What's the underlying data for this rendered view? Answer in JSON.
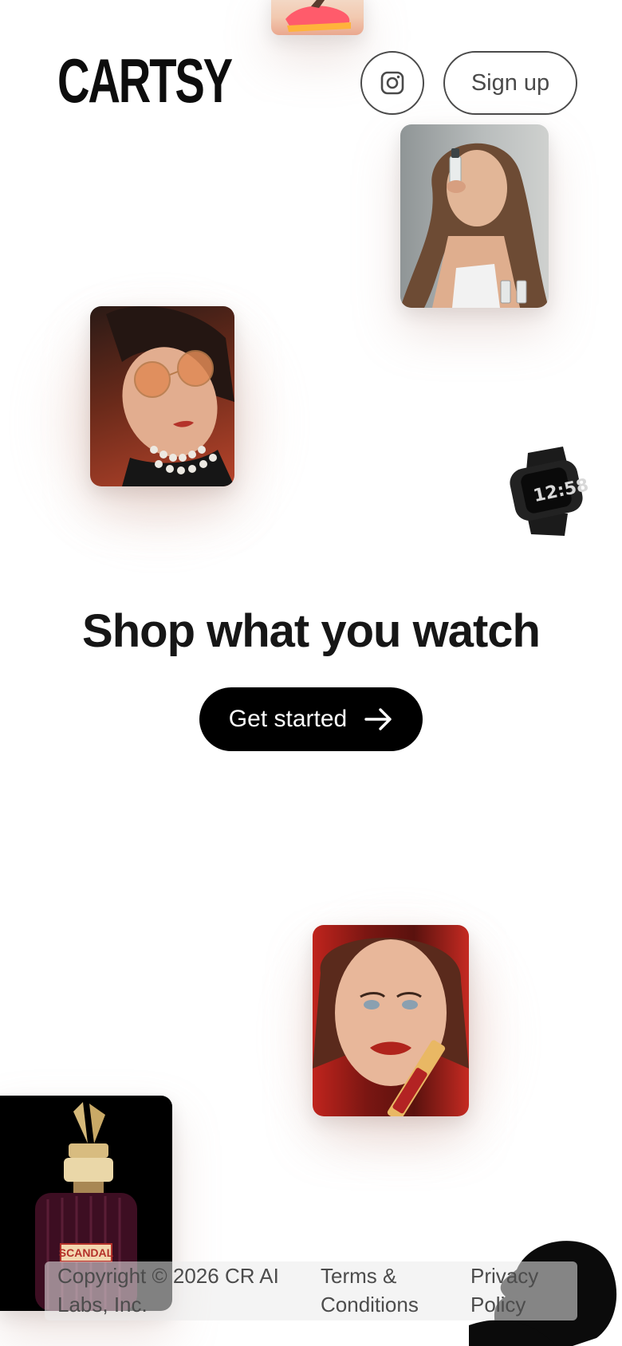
{
  "header": {
    "logo": "CARTSY",
    "instagram_icon": "instagram-icon",
    "signup_label": "Sign up"
  },
  "hero": {
    "headline": "Shop what you watch",
    "cta_label": "Get started",
    "cta_icon": "arrow-right-icon"
  },
  "products": [
    {
      "name": "sneaker-product-image"
    },
    {
      "name": "skincare-model-image"
    },
    {
      "name": "sunglasses-model-image"
    },
    {
      "name": "smartwatch-product-image"
    },
    {
      "name": "lipstick-model-image"
    },
    {
      "name": "perfume-bottle-image"
    },
    {
      "name": "silhouette-model-image"
    }
  ],
  "watch": {
    "time": "12:58"
  },
  "perfume": {
    "label": "SCANDAL"
  },
  "footer": {
    "copyright": "Copyright © 2026 CR AI Labs, Inc.",
    "terms": "Terms & Conditions",
    "privacy": "Privacy Policy"
  },
  "colors": {
    "text": "#161616",
    "cta_background": "#000000",
    "border": "#4a4a4a",
    "muted_text": "#4c4c4c"
  }
}
